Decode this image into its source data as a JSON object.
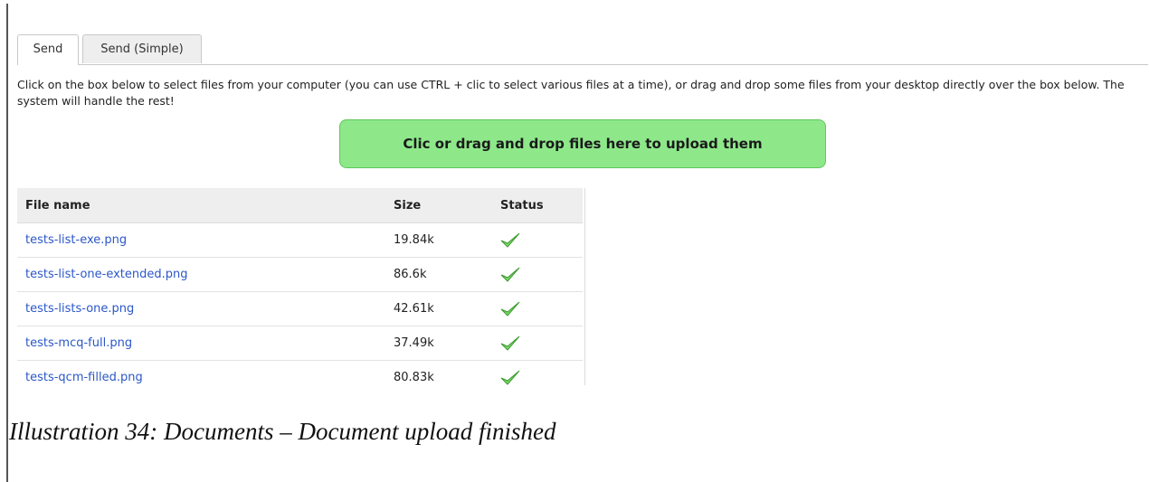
{
  "tabs": [
    {
      "label": "Send",
      "active": true
    },
    {
      "label": "Send (Simple)",
      "active": false
    }
  ],
  "instructions": "Click on the box below to select files from your computer (you can use CTRL + clic to select various files at a time), or drag and drop some files from your desktop directly over the box below. The system will handle the rest!",
  "dropzone": {
    "label": "Clic or drag and drop files here to upload them",
    "color": "#8ee88a"
  },
  "table": {
    "headers": {
      "name": "File name",
      "size": "Size",
      "status": "Status"
    },
    "rows": [
      {
        "name": "tests-list-exe.png",
        "size": "19.84k",
        "status": "check-icon"
      },
      {
        "name": "tests-list-one-extended.png",
        "size": "86.6k",
        "status": "check-icon"
      },
      {
        "name": "tests-lists-one.png",
        "size": "42.61k",
        "status": "check-icon"
      },
      {
        "name": "tests-mcq-full.png",
        "size": "37.49k",
        "status": "check-icon"
      },
      {
        "name": "tests-qcm-filled.png",
        "size": "80.83k",
        "status": "check-icon"
      }
    ]
  },
  "caption": "Illustration 34: Documents – Document upload finished"
}
